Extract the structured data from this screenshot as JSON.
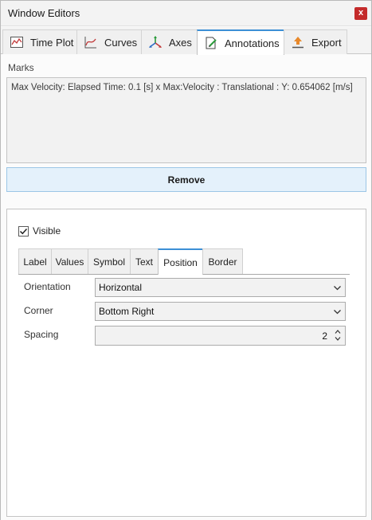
{
  "window": {
    "title": "Window Editors",
    "close_label": "x"
  },
  "tabs": [
    {
      "label": "Time Plot",
      "icon": "time-plot-icon"
    },
    {
      "label": "Curves",
      "icon": "curves-icon"
    },
    {
      "label": "Axes",
      "icon": "axes-icon"
    },
    {
      "label": "Annotations",
      "icon": "annotations-icon",
      "active": true
    },
    {
      "label": "Export",
      "icon": "export-icon"
    }
  ],
  "marks": {
    "label": "Marks",
    "items": [
      "Max Velocity: Elapsed Time: 0.1 [s] x Max:Velocity : Translational : Y: 0.654062 [m/s]"
    ],
    "remove_label": "Remove"
  },
  "panel": {
    "visible_label": "Visible",
    "visible_checked": true,
    "subtabs": [
      {
        "label": "Label"
      },
      {
        "label": "Values"
      },
      {
        "label": "Symbol"
      },
      {
        "label": "Text"
      },
      {
        "label": "Position",
        "active": true
      },
      {
        "label": "Border"
      }
    ],
    "orientation": {
      "label": "Orientation",
      "value": "Horizontal"
    },
    "corner": {
      "label": "Corner",
      "value": "Bottom Right"
    },
    "spacing": {
      "label": "Spacing",
      "value": "2"
    }
  },
  "colors": {
    "accent": "#3c8fd6",
    "close": "#c42b2b",
    "button_bg": "#e4f1fb"
  }
}
